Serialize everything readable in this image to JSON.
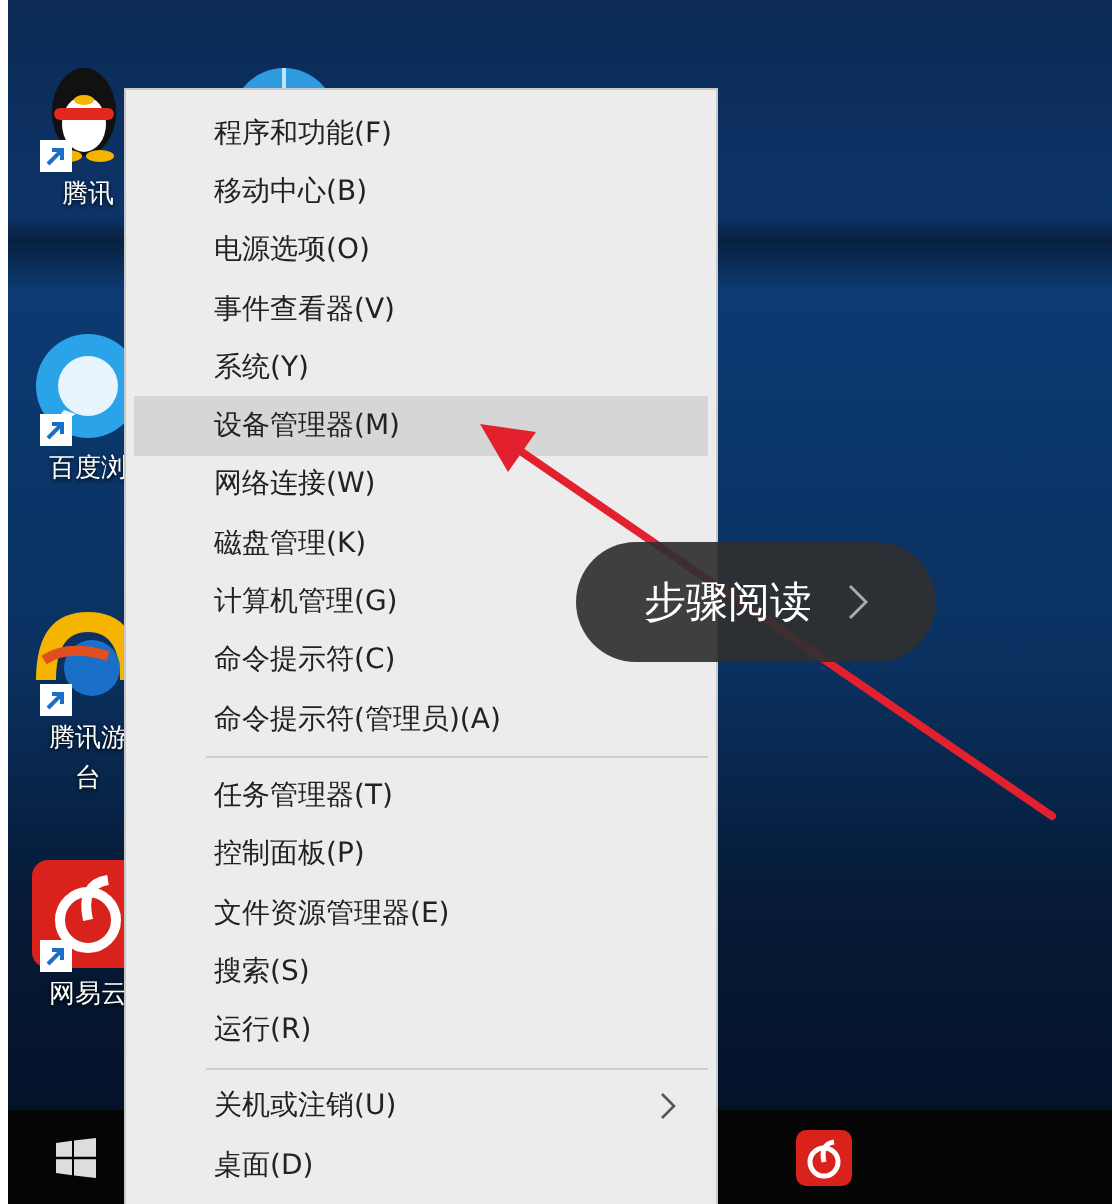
{
  "desktop": {
    "icons": [
      {
        "kind": "penguin",
        "lines": [
          "腾讯"
        ]
      },
      {
        "kind": "bubble",
        "lines": [
          "百度浏"
        ]
      },
      {
        "kind": "game",
        "lines": [
          "腾讯游",
          "台"
        ]
      },
      {
        "kind": "music",
        "lines": [
          "网易云"
        ]
      },
      {
        "kind": "globe"
      }
    ]
  },
  "menu": {
    "groups": [
      [
        {
          "label": "程序和功能(F)",
          "selected": false
        },
        {
          "label": "移动中心(B)",
          "selected": false
        },
        {
          "label": "电源选项(O)",
          "selected": false
        },
        {
          "label": "事件查看器(V)",
          "selected": false
        },
        {
          "label": "系统(Y)",
          "selected": false
        },
        {
          "label": "设备管理器(M)",
          "selected": true
        },
        {
          "label": "网络连接(W)",
          "selected": false
        },
        {
          "label": "磁盘管理(K)",
          "selected": false
        },
        {
          "label": "计算机管理(G)",
          "selected": false
        },
        {
          "label": "命令提示符(C)",
          "selected": false
        },
        {
          "label": "命令提示符(管理员)(A)",
          "selected": false
        }
      ],
      [
        {
          "label": "任务管理器(T)",
          "selected": false
        },
        {
          "label": "控制面板(P)",
          "selected": false
        },
        {
          "label": "文件资源管理器(E)",
          "selected": false
        },
        {
          "label": "搜索(S)",
          "selected": false
        },
        {
          "label": "运行(R)",
          "selected": false
        }
      ],
      [
        {
          "label": "关机或注销(U)",
          "selected": false,
          "submenu": true
        },
        {
          "label": "桌面(D)",
          "selected": false,
          "submenu": false
        }
      ]
    ]
  },
  "overlay_button": {
    "label": "步骤阅读"
  }
}
